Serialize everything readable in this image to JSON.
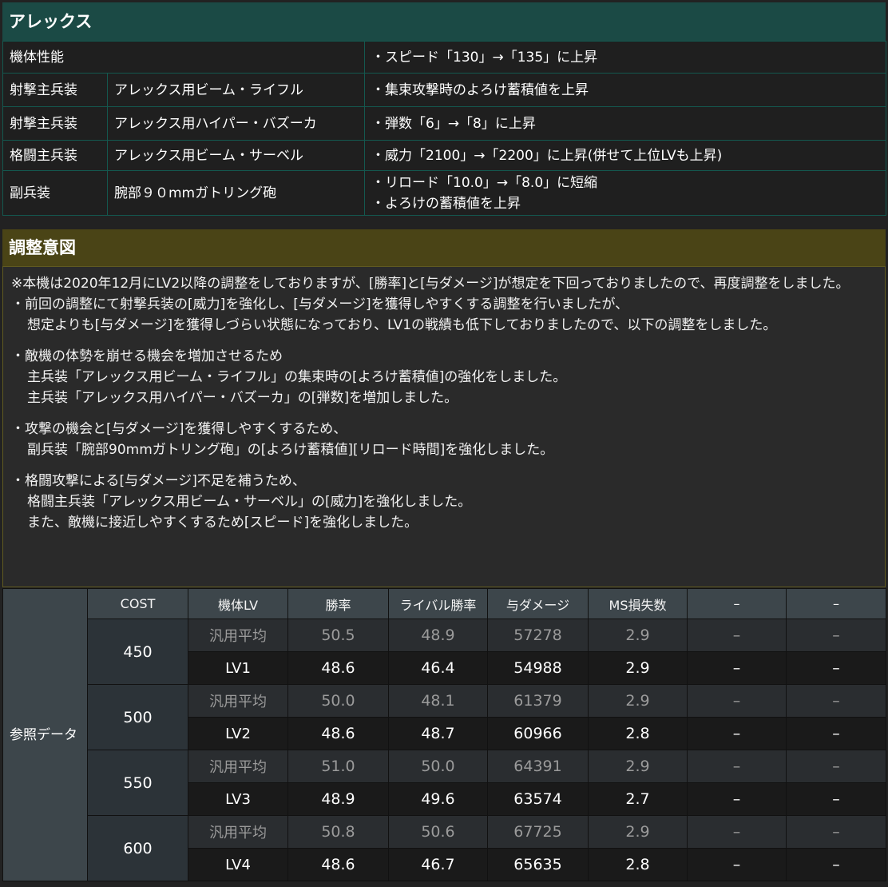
{
  "title": "アレックス",
  "spec_rows": [
    {
      "category": "機体性能",
      "weapon": "",
      "notes": [
        "・スピード「130」→「135」に上昇"
      ]
    },
    {
      "category": "射撃主兵装",
      "weapon": "アレックス用ビーム・ライフル",
      "notes": [
        "・集束攻撃時のよろけ蓄積値を上昇"
      ]
    },
    {
      "category": "射撃主兵装",
      "weapon": "アレックス用ハイパー・バズーカ",
      "notes": [
        "・弾数「6」→「8」に上昇"
      ]
    },
    {
      "category": "格闘主兵装",
      "weapon": "アレックス用ビーム・サーベル",
      "notes": [
        "・威力「2100」→「2200」に上昇(併せて上位LVも上昇)"
      ]
    },
    {
      "category": "副兵装",
      "weapon": "腕部９０mmガトリング砲",
      "notes": [
        "・リロード「10.0」→「8.0」に短縮",
        "・よろけの蓄積値を上昇"
      ]
    }
  ],
  "intent": {
    "title": "調整意図",
    "paragraphs": [
      [
        "※本機は2020年12月にLV2以降の調整をしておりますが、[勝率]と[与ダメージ]が想定を下回っておりましたので、再度調整をしました。",
        "・前回の調整にて射撃兵装の[威力]を強化し、[与ダメージ]を獲得しやすくする調整を行いましたが、",
        "想定よりも[与ダメージ]を獲得しづらい状態になっており、LV1の戦績も低下しておりましたので、以下の調整をしました。"
      ],
      [
        "・敵機の体勢を崩せる機会を増加させるため",
        "主兵装「アレックス用ビーム・ライフル」の集束時の[よろけ蓄積値]の強化をしました。",
        "主兵装「アレックス用ハイパー・バズーカ」の[弾数]を増加しました。"
      ],
      [
        "・攻撃の機会と[与ダメージ]を獲得しやすくするため、",
        "副兵装「腕部90mmガトリング砲」の[よろけ蓄積値][リロード時間]を強化しました。"
      ],
      [
        "・格闘攻撃による[与ダメージ]不足を補うため、",
        "格闘主兵装「アレックス用ビーム・サーベル」の[威力]を強化しました。",
        "また、敵機に接近しやすくするため[スピード]を強化しました。"
      ]
    ]
  },
  "reference": {
    "label": "参照データ",
    "headers": [
      "COST",
      "機体LV",
      "勝率",
      "ライバル勝率",
      "与ダメージ",
      "MS損失数",
      "–",
      "–"
    ],
    "groups": [
      {
        "cost": "450",
        "avg": [
          "汎用平均",
          "50.5",
          "48.9",
          "57278",
          "2.9",
          "–",
          "–"
        ],
        "lv": [
          "LV1",
          "48.6",
          "46.4",
          "54988",
          "2.9",
          "–",
          "–"
        ]
      },
      {
        "cost": "500",
        "avg": [
          "汎用平均",
          "50.0",
          "48.1",
          "61379",
          "2.9",
          "–",
          "–"
        ],
        "lv": [
          "LV2",
          "48.6",
          "48.7",
          "60966",
          "2.8",
          "–",
          "–"
        ]
      },
      {
        "cost": "550",
        "avg": [
          "汎用平均",
          "51.0",
          "50.0",
          "64391",
          "2.9",
          "–",
          "–"
        ],
        "lv": [
          "LV3",
          "48.9",
          "49.6",
          "63574",
          "2.7",
          "–",
          "–"
        ]
      },
      {
        "cost": "600",
        "avg": [
          "汎用平均",
          "50.8",
          "50.6",
          "67725",
          "2.9",
          "–",
          "–"
        ],
        "lv": [
          "LV4",
          "48.6",
          "46.7",
          "65635",
          "2.8",
          "–",
          "–"
        ]
      }
    ]
  }
}
